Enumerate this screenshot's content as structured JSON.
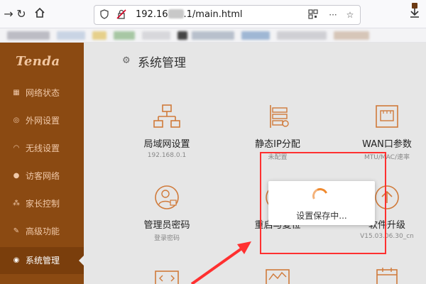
{
  "browser": {
    "url_prefix": "192.16",
    "url_suffix": ".1/main.html",
    "icons": [
      "forward-icon",
      "reload-icon",
      "home-icon",
      "shield-icon",
      "insecure-lock-icon",
      "qr-code-icon",
      "more-icon",
      "bookmark-star-icon",
      "download-icon"
    ]
  },
  "sidebar": {
    "logo": "Tenda",
    "items": [
      {
        "label": "网络状态",
        "icon": "network-status-icon"
      },
      {
        "label": "外网设置",
        "icon": "internet-settings-icon"
      },
      {
        "label": "无线设置",
        "icon": "wifi-icon"
      },
      {
        "label": "访客网络",
        "icon": "guest-network-icon"
      },
      {
        "label": "家长控制",
        "icon": "parental-control-icon"
      },
      {
        "label": "高级功能",
        "icon": "advanced-icon"
      },
      {
        "label": "系统管理",
        "icon": "system-icon",
        "active": true
      }
    ]
  },
  "main": {
    "title": "系统管理",
    "tiles": [
      {
        "label": "局域网设置",
        "sub": "192.168.0.1"
      },
      {
        "label": "静态IP分配",
        "sub": "未配置"
      },
      {
        "label": "WAN口参数",
        "sub": "MTU/MAC/速率"
      },
      {
        "label": "管理员密码",
        "sub": "登录密码"
      },
      {
        "label": "重启与复位",
        "sub": ""
      },
      {
        "label": "软件升级",
        "sub": "V15.03.06.30_cn"
      }
    ]
  },
  "modal": {
    "text": "设置保存中..."
  },
  "colors": {
    "sidebar": "#8b4a12",
    "accent": "#f08a2e",
    "annotation": "#ff3030"
  }
}
